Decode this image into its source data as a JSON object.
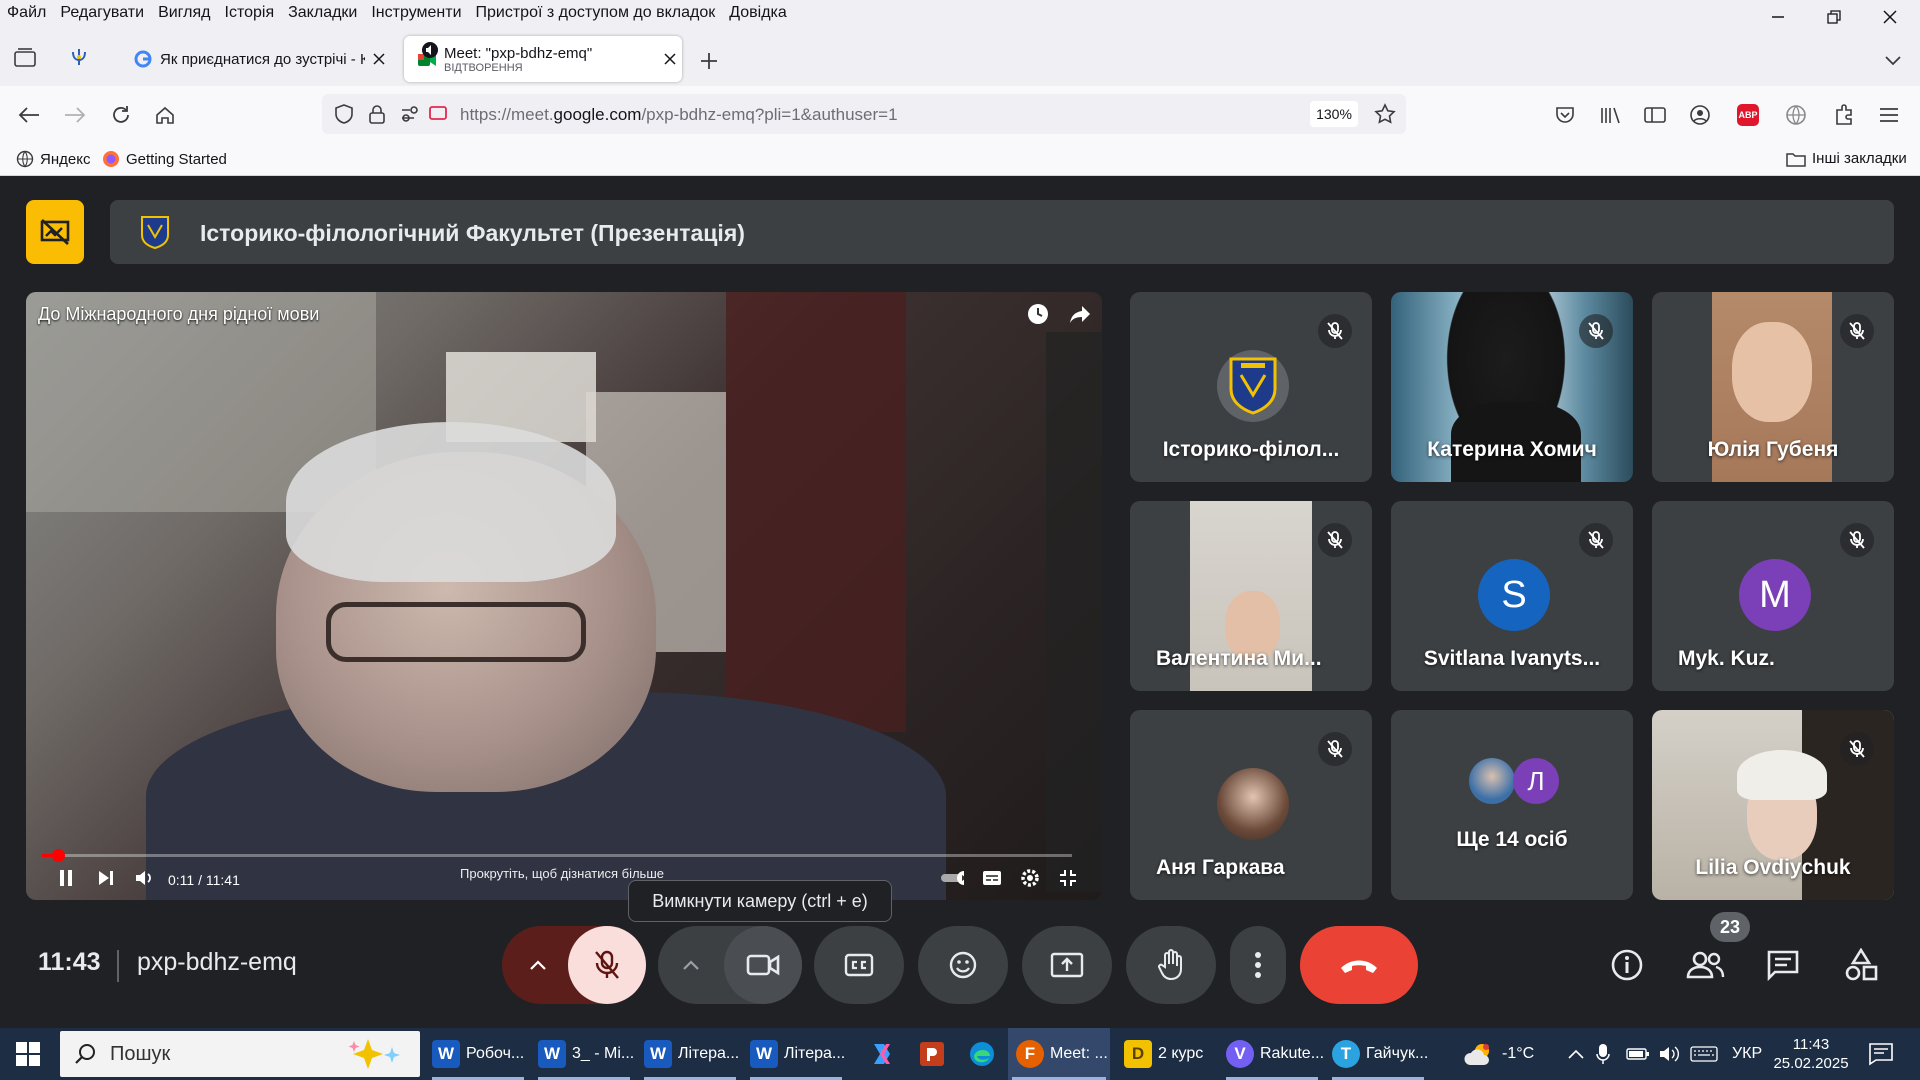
{
  "menubar": {
    "items": [
      "Файл",
      "Редагувати",
      "Вигляд",
      "Історія",
      "Закладки",
      "Інструменти",
      "Пристрої з доступом до вкладок",
      "Довідка"
    ]
  },
  "tabs": [
    {
      "title": "Як приєднатися до зустрічі - К",
      "active": false
    },
    {
      "title": "Meet: \"pxp-bdhz-emq\"",
      "subtitle": "ВІДТВОРЕННЯ",
      "active": true
    }
  ],
  "navbar": {
    "url_prefix": "https://meet.",
    "url_domain": "google.com",
    "url_suffix": "/pxp-bdhz-emq?pli=1&authuser=1",
    "zoom": "130%",
    "extension_badge": "ABP"
  },
  "bookmarks": {
    "items": [
      "Яндекс",
      "Getting Started"
    ],
    "other": "Інші закладки"
  },
  "meet": {
    "presentation_title": "Історико-філологічний Факультет (Презентація)",
    "video": {
      "title": "До Міжнародного дня рідної мови",
      "time": "0:11 / 11:41",
      "progress": 0.016,
      "hint": "Прокрутіть, щоб дізнатися більше"
    },
    "participants": [
      {
        "name": "Історико-філол...",
        "kind": "logo"
      },
      {
        "name": "Катерина Хомич",
        "kind": "photo-dark"
      },
      {
        "name": "Юлія Губеня",
        "kind": "photo-girl"
      },
      {
        "name": "Валентина Ми...",
        "kind": "photo-woman"
      },
      {
        "name": "Svitlana Ivanyts...",
        "kind": "avatar",
        "initial": "S",
        "color": "#1565c0"
      },
      {
        "name": "Myk. Kuz.",
        "kind": "avatar",
        "initial": "M",
        "color": "#7b3fb8"
      },
      {
        "name": "Аня Гаркава",
        "kind": "small-photo"
      },
      {
        "name": "Ще 14 осіб",
        "kind": "more",
        "initial": "Л",
        "color": "#7b3fb8"
      },
      {
        "name": "Lilia Ovdiychuk",
        "kind": "photo-elder"
      }
    ],
    "tooltip": "Вимкнути камеру (ctrl + e)",
    "clock": "11:43",
    "meeting_code": "pxp-bdhz-emq",
    "participant_count": "23"
  },
  "taskbar": {
    "search_placeholder": "Пошук",
    "apps": [
      {
        "label": "Робоч...",
        "icon": "W",
        "color": "#185abd"
      },
      {
        "label": "3_ - Мі...",
        "icon": "W",
        "color": "#185abd"
      },
      {
        "label": "Літера...",
        "icon": "W",
        "color": "#185abd"
      },
      {
        "label": "Літера...",
        "icon": "W",
        "color": "#185abd"
      },
      {
        "label": "Meet: ...",
        "icon": "F",
        "color": "#e66000"
      },
      {
        "label": "2 курс",
        "icon": "D",
        "color": "#f2c200"
      },
      {
        "label": "Rakute...",
        "icon": "V",
        "color": "#7360f2"
      },
      {
        "label": "Гайчук...",
        "icon": "T",
        "color": "#2aa3e0"
      }
    ],
    "weather": "-1°C",
    "lang": "УКР",
    "time": "11:43",
    "date": "25.02.2025"
  }
}
